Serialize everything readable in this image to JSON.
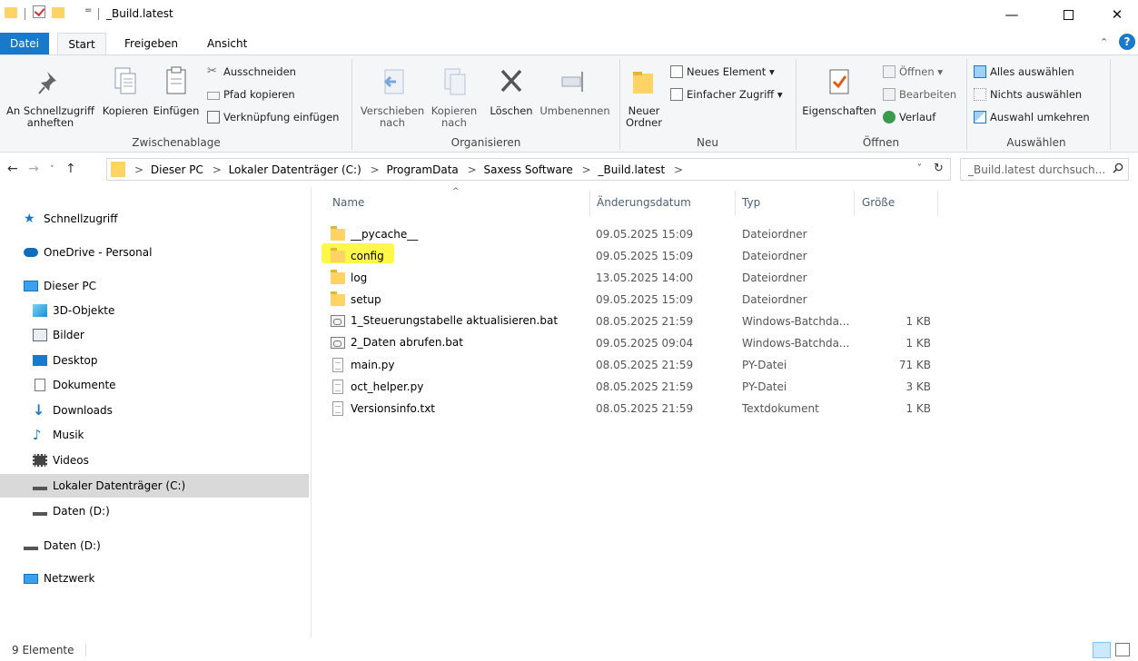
{
  "window": {
    "title": "_Build.latest",
    "minimize_glyph": "—",
    "maximize_glyph": "",
    "close_glyph": "✕",
    "qat_dropdown": "="
  },
  "ribbon_tabs": {
    "file": "Datei",
    "start": "Start",
    "share": "Freigeben",
    "view": "Ansicht",
    "collapse_glyph": "⌃",
    "help_glyph": "?"
  },
  "ribbon": {
    "clipboard": {
      "label": "Zwischenablage",
      "pin": "An Schnellzugriff anheften",
      "copy": "Kopieren",
      "paste": "Einfügen",
      "cut": "Ausschneiden",
      "copy_path": "Pfad kopieren",
      "paste_shortcut": "Verknüpfung einfügen"
    },
    "organize": {
      "label": "Organisieren",
      "move_to": "Verschieben nach",
      "copy_to": "Kopieren nach",
      "delete": "Löschen",
      "rename": "Umbenennen"
    },
    "new": {
      "label": "Neu",
      "new_folder": "Neuer Ordner",
      "new_item": "Neues Element ▾",
      "easy_access": "Einfacher Zugriff ▾"
    },
    "open": {
      "label": "Öffnen",
      "properties": "Eigenschaften",
      "open": "Öffnen ▾",
      "edit": "Bearbeiten",
      "history": "Verlauf"
    },
    "select": {
      "label": "Auswählen",
      "select_all": "Alles auswählen",
      "select_none": "Nichts auswählen",
      "invert": "Auswahl umkehren"
    }
  },
  "nav": {
    "back": "←",
    "forward": "→",
    "recent": "˅",
    "up": "↑",
    "refresh": "↻",
    "dropdown": "˅"
  },
  "address": {
    "crumbs": [
      "Dieser PC",
      "Lokaler Datenträger (C:)",
      "ProgramData",
      "Saxess Software",
      "_Build.latest"
    ],
    "separator": ">"
  },
  "search": {
    "placeholder": "_Build.latest durchsuch..."
  },
  "sidebar": {
    "items": [
      {
        "label": "Schnellzugriff",
        "icon": "star-icon"
      },
      {
        "label": "OneDrive - Personal",
        "icon": "cloud-icon"
      },
      {
        "label": "Dieser PC",
        "icon": "pc-icon"
      },
      {
        "label": "3D-Objekte",
        "icon": "cube-icon"
      },
      {
        "label": "Bilder",
        "icon": "pictures-icon"
      },
      {
        "label": "Desktop",
        "icon": "desktop-icon"
      },
      {
        "label": "Dokumente",
        "icon": "documents-icon"
      },
      {
        "label": "Downloads",
        "icon": "download-icon"
      },
      {
        "label": "Musik",
        "icon": "music-icon"
      },
      {
        "label": "Videos",
        "icon": "videos-icon"
      },
      {
        "label": "Lokaler Datenträger (C:)",
        "icon": "drive-icon"
      },
      {
        "label": "Daten (D:)",
        "icon": "drive-icon"
      },
      {
        "label": "Daten (D:)",
        "icon": "drive-icon"
      },
      {
        "label": "Netzwerk",
        "icon": "network-icon"
      }
    ]
  },
  "columns": {
    "name": "Name",
    "date": "Änderungsdatum",
    "type": "Typ",
    "size": "Größe",
    "sort_glyph": "^"
  },
  "files": [
    {
      "name": "__pycache__",
      "date": "09.05.2025 15:09",
      "type": "Dateiordner",
      "size": "",
      "icon": "folder-icon"
    },
    {
      "name": "config",
      "date": "09.05.2025 15:09",
      "type": "Dateiordner",
      "size": "",
      "icon": "folder-icon"
    },
    {
      "name": "log",
      "date": "13.05.2025 14:00",
      "type": "Dateiordner",
      "size": "",
      "icon": "folder-icon"
    },
    {
      "name": "setup",
      "date": "09.05.2025 15:09",
      "type": "Dateiordner",
      "size": "",
      "icon": "folder-icon"
    },
    {
      "name": "1_Steuerungstabelle aktualisieren.bat",
      "date": "08.05.2025 21:59",
      "type": "Windows-Batchda...",
      "size": "1 KB",
      "icon": "batch-file-icon"
    },
    {
      "name": "2_Daten abrufen.bat",
      "date": "09.05.2025 09:04",
      "type": "Windows-Batchda...",
      "size": "1 KB",
      "icon": "batch-file-icon"
    },
    {
      "name": "main.py",
      "date": "08.05.2025 21:59",
      "type": "PY-Datei",
      "size": "71 KB",
      "icon": "document-icon"
    },
    {
      "name": "oct_helper.py",
      "date": "08.05.2025 21:59",
      "type": "PY-Datei",
      "size": "3 KB",
      "icon": "document-icon"
    },
    {
      "name": "Versionsinfo.txt",
      "date": "08.05.2025 21:59",
      "type": "Textdokument",
      "size": "1 KB",
      "icon": "document-icon"
    }
  ],
  "status": {
    "count": "9 Elemente"
  },
  "colors": {
    "accent": "#1979ca",
    "folder": "#ffd465",
    "highlight": "#fff62a",
    "selection": "#d9d9d9"
  }
}
